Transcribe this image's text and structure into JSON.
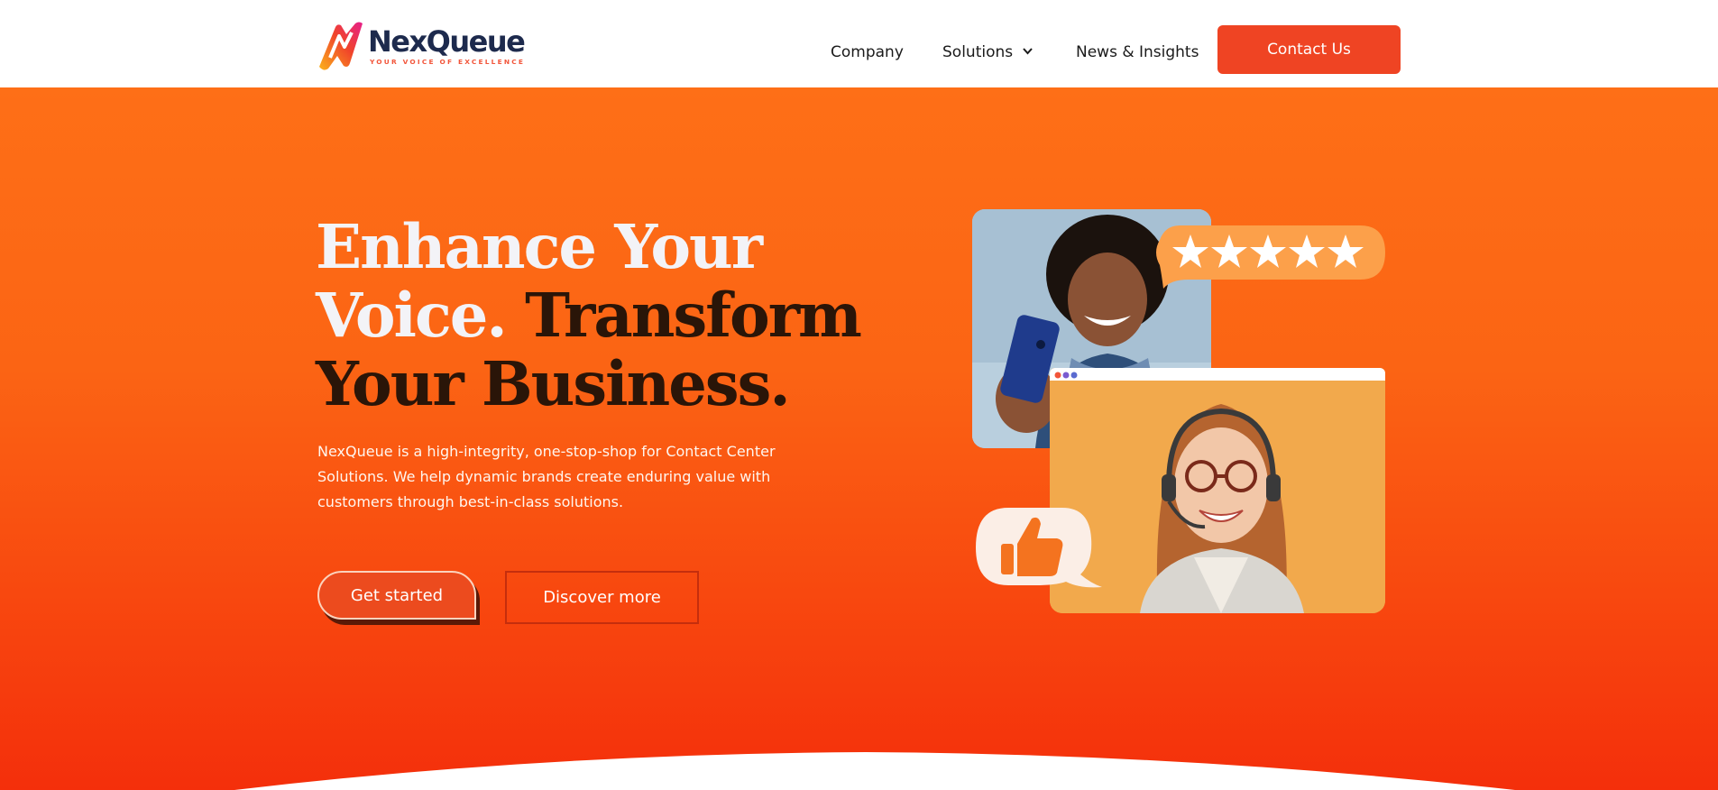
{
  "brand": {
    "name": "NexQueue",
    "tagline": "YOUR VOICE OF EXCELLENCE",
    "colors": {
      "navy": "#1d2a4d",
      "orange": "#ef4423",
      "accent": "#fe6f17"
    }
  },
  "nav": {
    "items": [
      {
        "label": "Company"
      },
      {
        "label": "Solutions",
        "icon": "chevron-down-icon"
      },
      {
        "label": "News & Insights"
      }
    ],
    "cta": "Contact Us"
  },
  "hero": {
    "headline": {
      "line1": "Enhance Your",
      "line2_white": "Voice.",
      "line2_dark": "Transform",
      "line3": "Your Business."
    },
    "description": "NexQueue is a high-integrity, one-stop-shop for Contact Center Solutions. We help dynamic brands create enduring value with customers through best-in-class solutions.",
    "buttons": {
      "primary": "Get started",
      "secondary": "Discover more"
    },
    "illustration": {
      "rating_stars": 5,
      "icons": [
        "star-icon",
        "thumbs-up-icon"
      ]
    }
  }
}
